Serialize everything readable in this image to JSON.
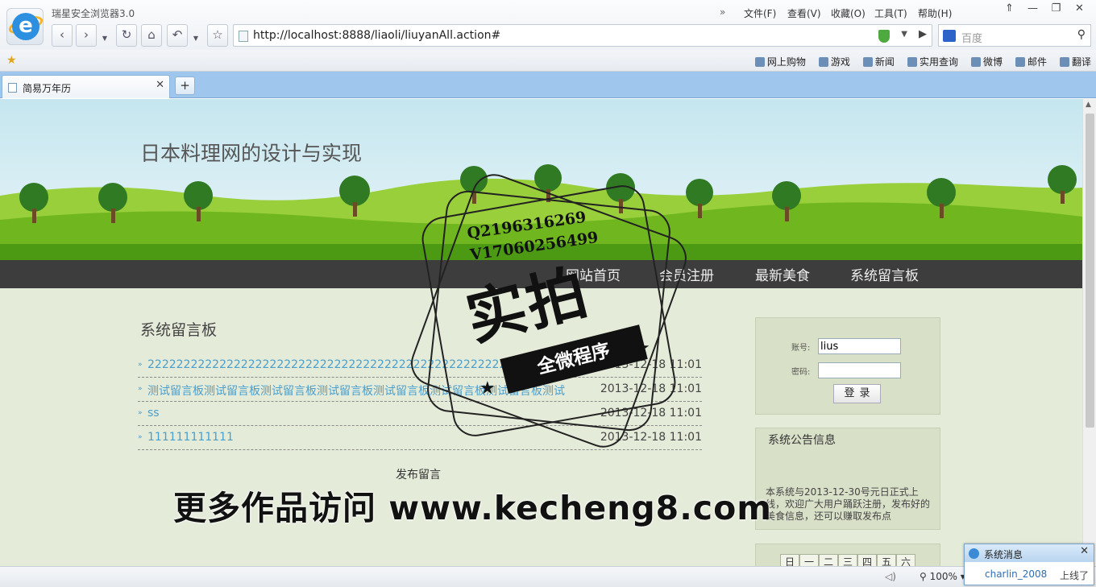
{
  "browser": {
    "app_title": "瑞星安全浏览器3.0",
    "menu": [
      "文件(F)",
      "查看(V)",
      "收藏(O)",
      "工具(T)",
      "帮助(H)"
    ],
    "menu_more": "»",
    "url": "http://localhost:8888/liaoli/liuyanAll.action#",
    "search_placeholder": "百度",
    "favorites": [
      "网上购物",
      "游戏",
      "新闻",
      "实用查询",
      "微博",
      "邮件",
      "翻译"
    ],
    "tab_title": "简易万年历",
    "zoom": "100%"
  },
  "site": {
    "title": "日本料理网的设计与实现",
    "nav": [
      "网站首页",
      "会员注册",
      "最新美食",
      "系统留言板"
    ]
  },
  "messages": {
    "section_title": "系统留言板",
    "items": [
      {
        "text": "2222222222222222222222222222222222222222222222222222222222",
        "date": "2013-12-18 11:01"
      },
      {
        "text": "测试留言板测试留言板测试留言板测试留言板测试留言板测试留言板测试留言板测试",
        "date": "2013-12-18 11:01"
      },
      {
        "text": "ss",
        "date": "2013-12-18 11:01"
      },
      {
        "text": "111111111111",
        "date": "2013-12-18 11:01"
      }
    ],
    "post_label": "发布留言"
  },
  "login": {
    "account_label": "账号:",
    "account_value": "lius",
    "password_label": "密码:",
    "submit_label": "登录"
  },
  "notice": {
    "title": "系统公告信息",
    "body": "本系统与2013-12-30号元日正式上线，欢迎广大用户踊跃注册，发布好的美食信息，还可以赚取发布点"
  },
  "calendar": {
    "weekdays": [
      "日",
      "一",
      "二",
      "三",
      "四",
      "五",
      "六"
    ]
  },
  "watermark": {
    "phone1": "Q2196316269",
    "phone2": "V17060256499",
    "stamp_main": "实拍",
    "stamp_ribbon": "全微程序",
    "footer": "更多作品访问 www.kecheng8.com"
  },
  "notification": {
    "title": "系统消息",
    "user": "charlin_2008",
    "status": "上线了"
  }
}
